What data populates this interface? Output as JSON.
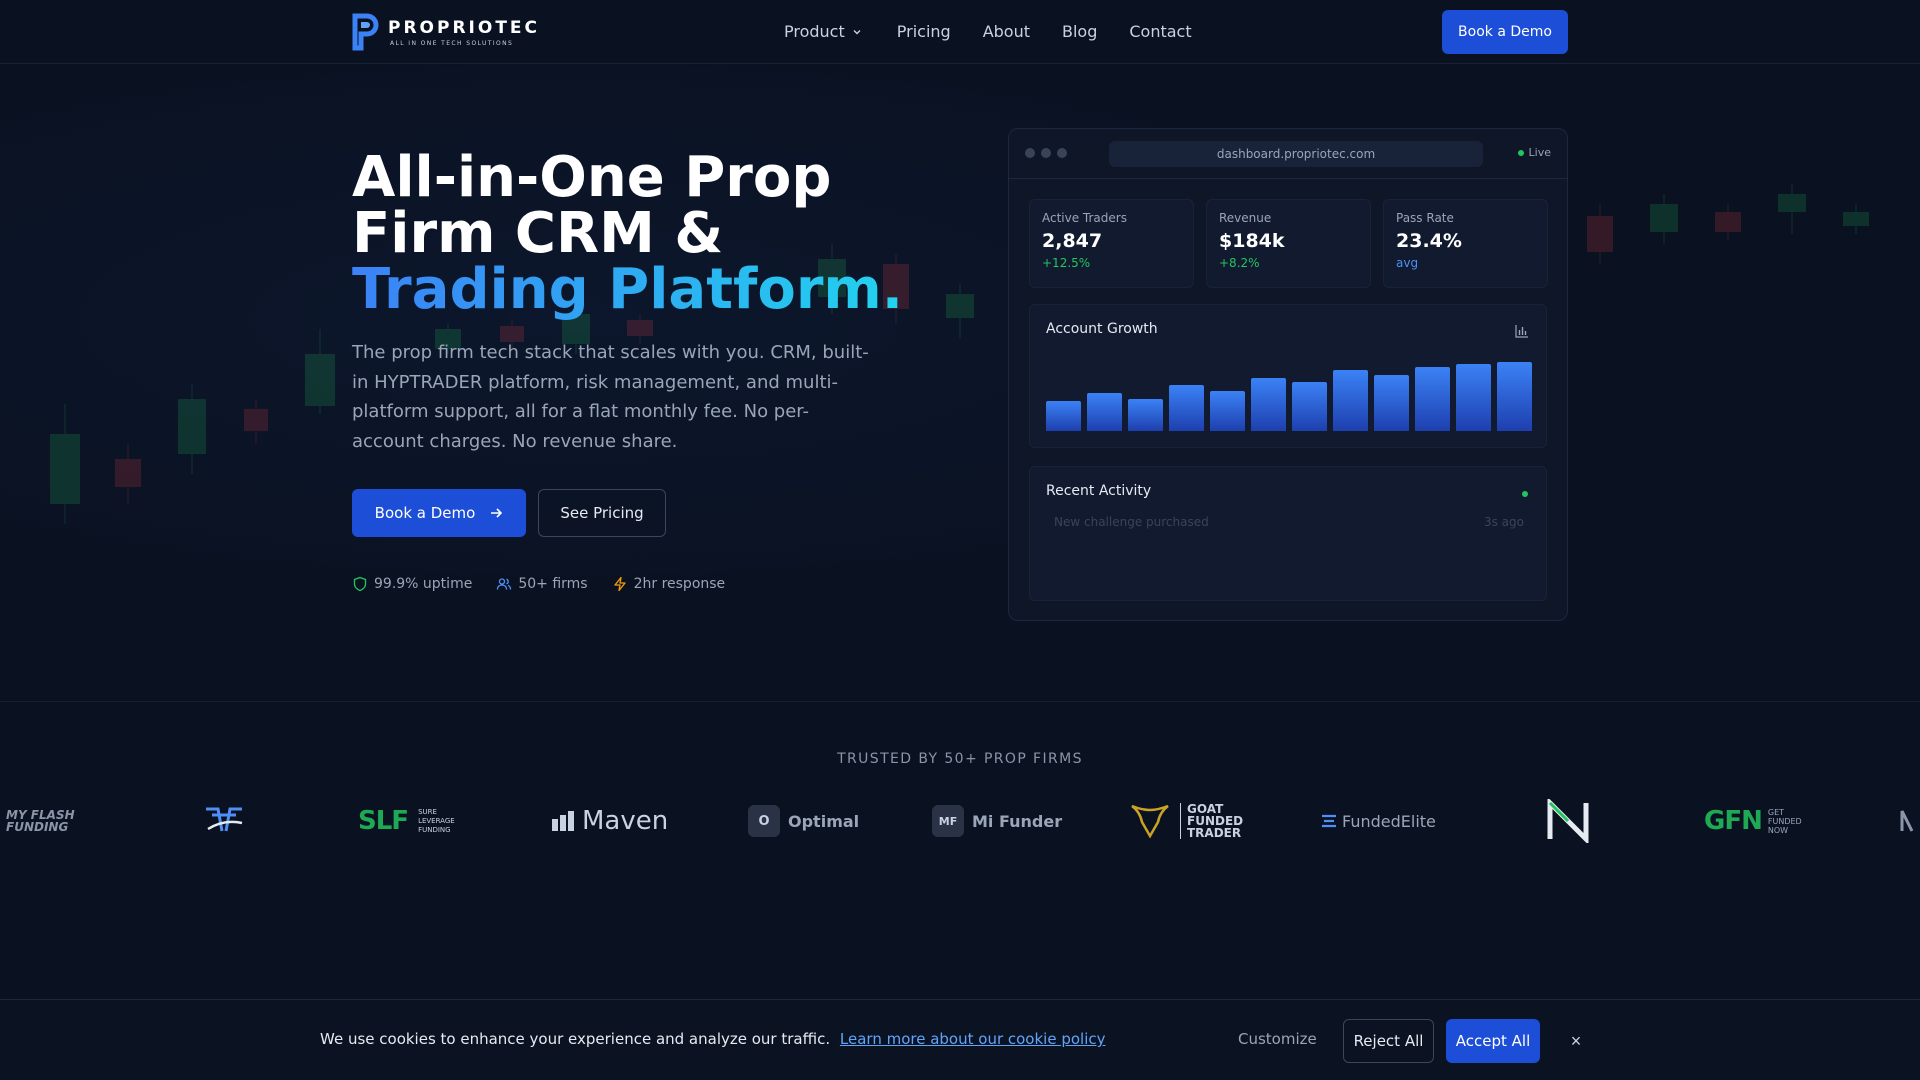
{
  "nav": {
    "logo_name": "PROPRIOTEC",
    "logo_tagline": "ALL IN ONE TECH SOLUTIONS",
    "links": [
      "Product",
      "Pricing",
      "About",
      "Blog",
      "Contact"
    ],
    "cta": "Book a Demo"
  },
  "hero": {
    "title_line1": "All-in-One Prop",
    "title_line2": "Firm CRM &",
    "title_line3": "Trading Platform.",
    "description": "The prop firm tech stack that scales with you. CRM, built-in HYPTRADER platform, risk management, and multi-platform support, all for a flat monthly fee. No per-account charges. No revenue share.",
    "primary_button": "Book a Demo",
    "secondary_button": "See Pricing",
    "stats": [
      {
        "icon": "shield-icon",
        "label": "99.9% uptime"
      },
      {
        "icon": "users-icon",
        "label": "50+ firms"
      },
      {
        "icon": "bolt-icon",
        "label": "2hr response"
      }
    ]
  },
  "dashboard": {
    "url": "dashboard.propriotec.com",
    "status": "Live",
    "kpis": [
      {
        "label": "Active Traders",
        "value": "2,847",
        "change": "+12.5%"
      },
      {
        "label": "Revenue",
        "value": "$184k",
        "change": "+8.2%"
      },
      {
        "label": "Pass Rate",
        "value": "23.4%",
        "change": "avg"
      }
    ],
    "growth_title": "Account Growth",
    "growth_bars": [
      0.4,
      0.52,
      0.43,
      0.62,
      0.54,
      0.72,
      0.66,
      0.83,
      0.76,
      0.86,
      0.9,
      0.93
    ],
    "activity_title": "Recent Activity",
    "activity_item": "New challenge purchased",
    "activity_time": "3s ago"
  },
  "trusted": {
    "label": "TRUSTED BY 50+ PROP FIRMS",
    "logos": [
      {
        "name": "MY FLASH FUNDING"
      },
      {
        "name": "SLF",
        "sub": "SURE LEVERAGE FUNDING"
      },
      {
        "name": "Maven"
      },
      {
        "name": "Optimal",
        "badge": "O"
      },
      {
        "name": "Mi Funder",
        "badge": "MF"
      },
      {
        "name": "GOAT FUNDED TRADER"
      },
      {
        "name": "FundedElite"
      },
      {
        "name": "GFN",
        "sub": "GET FUNDED NOW"
      }
    ]
  },
  "cookie": {
    "text": "We use cookies to enhance your experience and analyze our traffic.",
    "link": "Learn more about our cookie policy",
    "customize": "Customize",
    "reject": "Reject All",
    "accept": "Accept All",
    "close": "×"
  },
  "colors": {
    "background": "#0a1120",
    "accent": "#1d4ed8",
    "positive": "#22c55e",
    "gradient_start": "#3b82f6",
    "gradient_end": "#22d3ee"
  }
}
